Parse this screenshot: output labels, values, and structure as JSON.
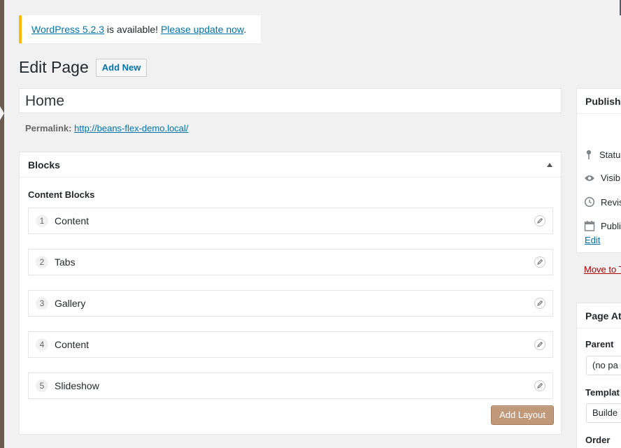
{
  "notice": {
    "version_link": "WordPress 5.2.3",
    "middle_text": " is available! ",
    "update_link": "Please update now",
    "end_text": "."
  },
  "header": {
    "title": "Edit Page",
    "add_new_label": "Add New"
  },
  "post": {
    "title": "Home",
    "permalink_label": "Permalink:",
    "permalink_url": "http://beans-flex-demo.local/"
  },
  "blocks": {
    "heading": "Blocks",
    "content_label": "Content Blocks",
    "rows": [
      {
        "num": "1",
        "label": "Content"
      },
      {
        "num": "2",
        "label": "Tabs"
      },
      {
        "num": "3",
        "label": "Gallery"
      },
      {
        "num": "4",
        "label": "Content"
      },
      {
        "num": "5",
        "label": "Slideshow"
      }
    ],
    "add_layout_label": "Add Layout"
  },
  "publish": {
    "title": "Publish",
    "status": "Statu",
    "visibility": "Visib",
    "revisions": "Revis",
    "published": "Publi",
    "edit_link": "Edit",
    "trash_link": "Move to T"
  },
  "attributes": {
    "title": "Page At",
    "parent_label": "Parent",
    "parent_value": "(no pa",
    "template_label": "Templat",
    "template_value": "Builde",
    "order_label": "Order"
  },
  "colors": {
    "accent": "#0073aa",
    "notice_border": "#ffb900",
    "add_layout_bg": "#c0997a",
    "trash": "#a00000"
  }
}
